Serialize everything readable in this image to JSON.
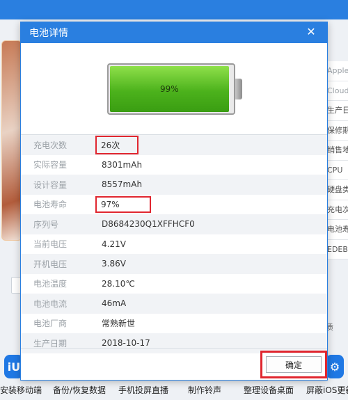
{
  "dialog": {
    "title": "电池详情",
    "close_label": "✕",
    "battery_percent": 97,
    "battery_label": "99%",
    "ok_label": "确定",
    "rows": [
      {
        "label": "充电次数",
        "value": "26次"
      },
      {
        "label": "实际容量",
        "value": "8301mAh"
      },
      {
        "label": "设计容量",
        "value": "8557mAh"
      },
      {
        "label": "电池寿命",
        "value": "97%"
      },
      {
        "label": "序列号",
        "value": "D8684230Q1XFFHCF0"
      },
      {
        "label": "当前电压",
        "value": "4.21V"
      },
      {
        "label": "开机电压",
        "value": "3.86V"
      },
      {
        "label": "电池温度",
        "value": "28.10℃"
      },
      {
        "label": "电池电流",
        "value": "46mA"
      },
      {
        "label": "电池厂商",
        "value": "常熟新世"
      },
      {
        "label": "生产日期",
        "value": "2018-10-17"
      }
    ]
  },
  "background": {
    "right_column": [
      "Apple",
      "Cloud",
      "生产日",
      "保修期",
      "销售地",
      "CPU",
      "硬盘类",
      "充电次",
      "电池寿",
      "EDEBE"
    ],
    "stray_text": "质",
    "toolbar": [
      {
        "icon": "iU",
        "label": "安装移动端"
      },
      {
        "label": "备份/恢复数据"
      },
      {
        "label": "手机投屏直播"
      },
      {
        "label": "制作铃声"
      },
      {
        "label": "整理设备桌面"
      },
      {
        "label": "屏蔽iOS更新"
      }
    ]
  },
  "colors": {
    "accent": "#2a7fe0",
    "highlight": "#e0262f",
    "battery": "#4cb21c"
  }
}
